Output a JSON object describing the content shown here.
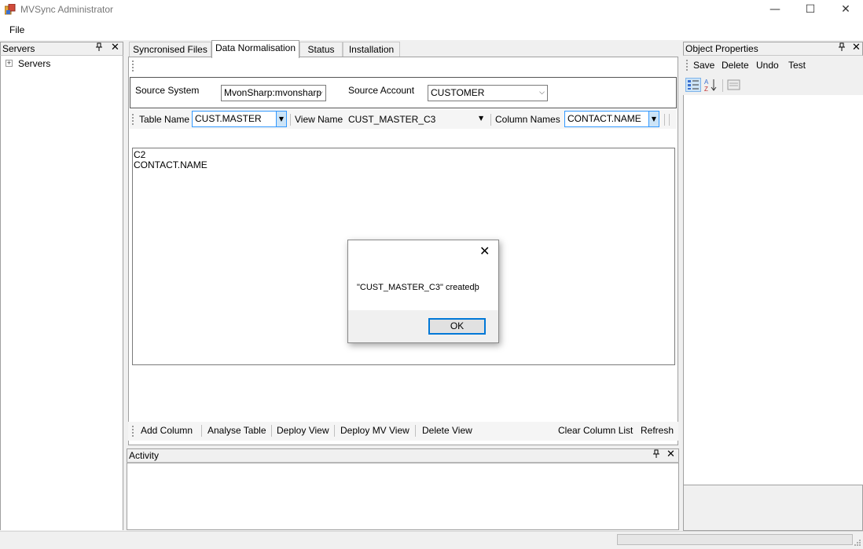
{
  "window": {
    "title": "MVSync Administrator",
    "minimize": "—",
    "maximize": "☐",
    "close": "✕"
  },
  "menu": {
    "file": "File"
  },
  "servers_panel": {
    "title": "Servers",
    "pin": "🖈",
    "close": "✕",
    "tree_root": "Servers",
    "expander": "+"
  },
  "tabs": [
    {
      "label": "Syncronised Files"
    },
    {
      "label": "Data Normalisation"
    },
    {
      "label": "Status"
    },
    {
      "label": "Installation"
    }
  ],
  "source": {
    "system_label": "Source System",
    "system_value": "MvonSharp:mvonsharp",
    "account_label": "Source Account",
    "account_value": "CUSTOMER"
  },
  "toolstrip": {
    "table_label": "Table Name",
    "table_value": "CUST.MASTER",
    "view_label": "View Name",
    "view_value": "CUST_MASTER_C3",
    "column_label": "Column Names",
    "column_value": "CONTACT.NAME"
  },
  "textarea": {
    "line1": "C2",
    "line2": "CONTACT.NAME"
  },
  "bottom_actions": {
    "add_column": "Add Column",
    "analyse_table": "Analyse Table",
    "deploy_view": "Deploy View",
    "deploy_mv_view": "Deploy MV View",
    "delete_view": "Delete View",
    "clear_column_list": "Clear Column List",
    "refresh": "Refresh"
  },
  "activity_panel": {
    "title": "Activity",
    "pin": "🖈",
    "close": "✕"
  },
  "object_properties": {
    "title": "Object Properties",
    "pin": "🖈",
    "close": "✕",
    "save": "Save",
    "delete": "Delete",
    "undo": "Undo",
    "test": "Test"
  },
  "dialog": {
    "message": "\"CUST_MASTER_C3\" createdþ",
    "ok": "OK",
    "close": "✕"
  }
}
